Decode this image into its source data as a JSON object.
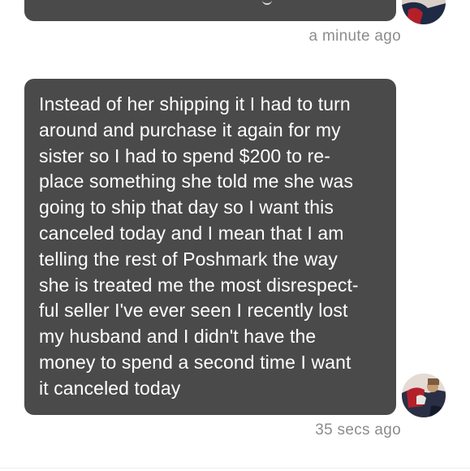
{
  "conversation": {
    "messages": [
      {
        "id": "msg-previous",
        "text": "",
        "timestamp": "a minute ago"
      },
      {
        "id": "msg-latest",
        "text": "Instead of her shipping it I had to turn\naround and purchase it again for my\nsister so I had to spend $200 to re-\nplace something she told me she was\ngoing to ship that day so I want this\ncanceled today and I mean that I am\ntelling the rest of Poshmark the way\nshe is treated me the most disrespect-\nful seller I've ever seen I recently lost\nmy husband and I didn't have the\nmoney to spend a second time I want\nit canceled today",
        "timestamp": "35 secs ago"
      }
    ]
  },
  "colors": {
    "bubble_background": "#4a4a4a",
    "bubble_text": "#ffffff",
    "timestamp_text": "#8c8c8c",
    "avatar_accent_red": "#b3202a",
    "avatar_accent_navy": "#1f2a44"
  },
  "icons": {
    "avatar": "user-avatar-photo"
  }
}
